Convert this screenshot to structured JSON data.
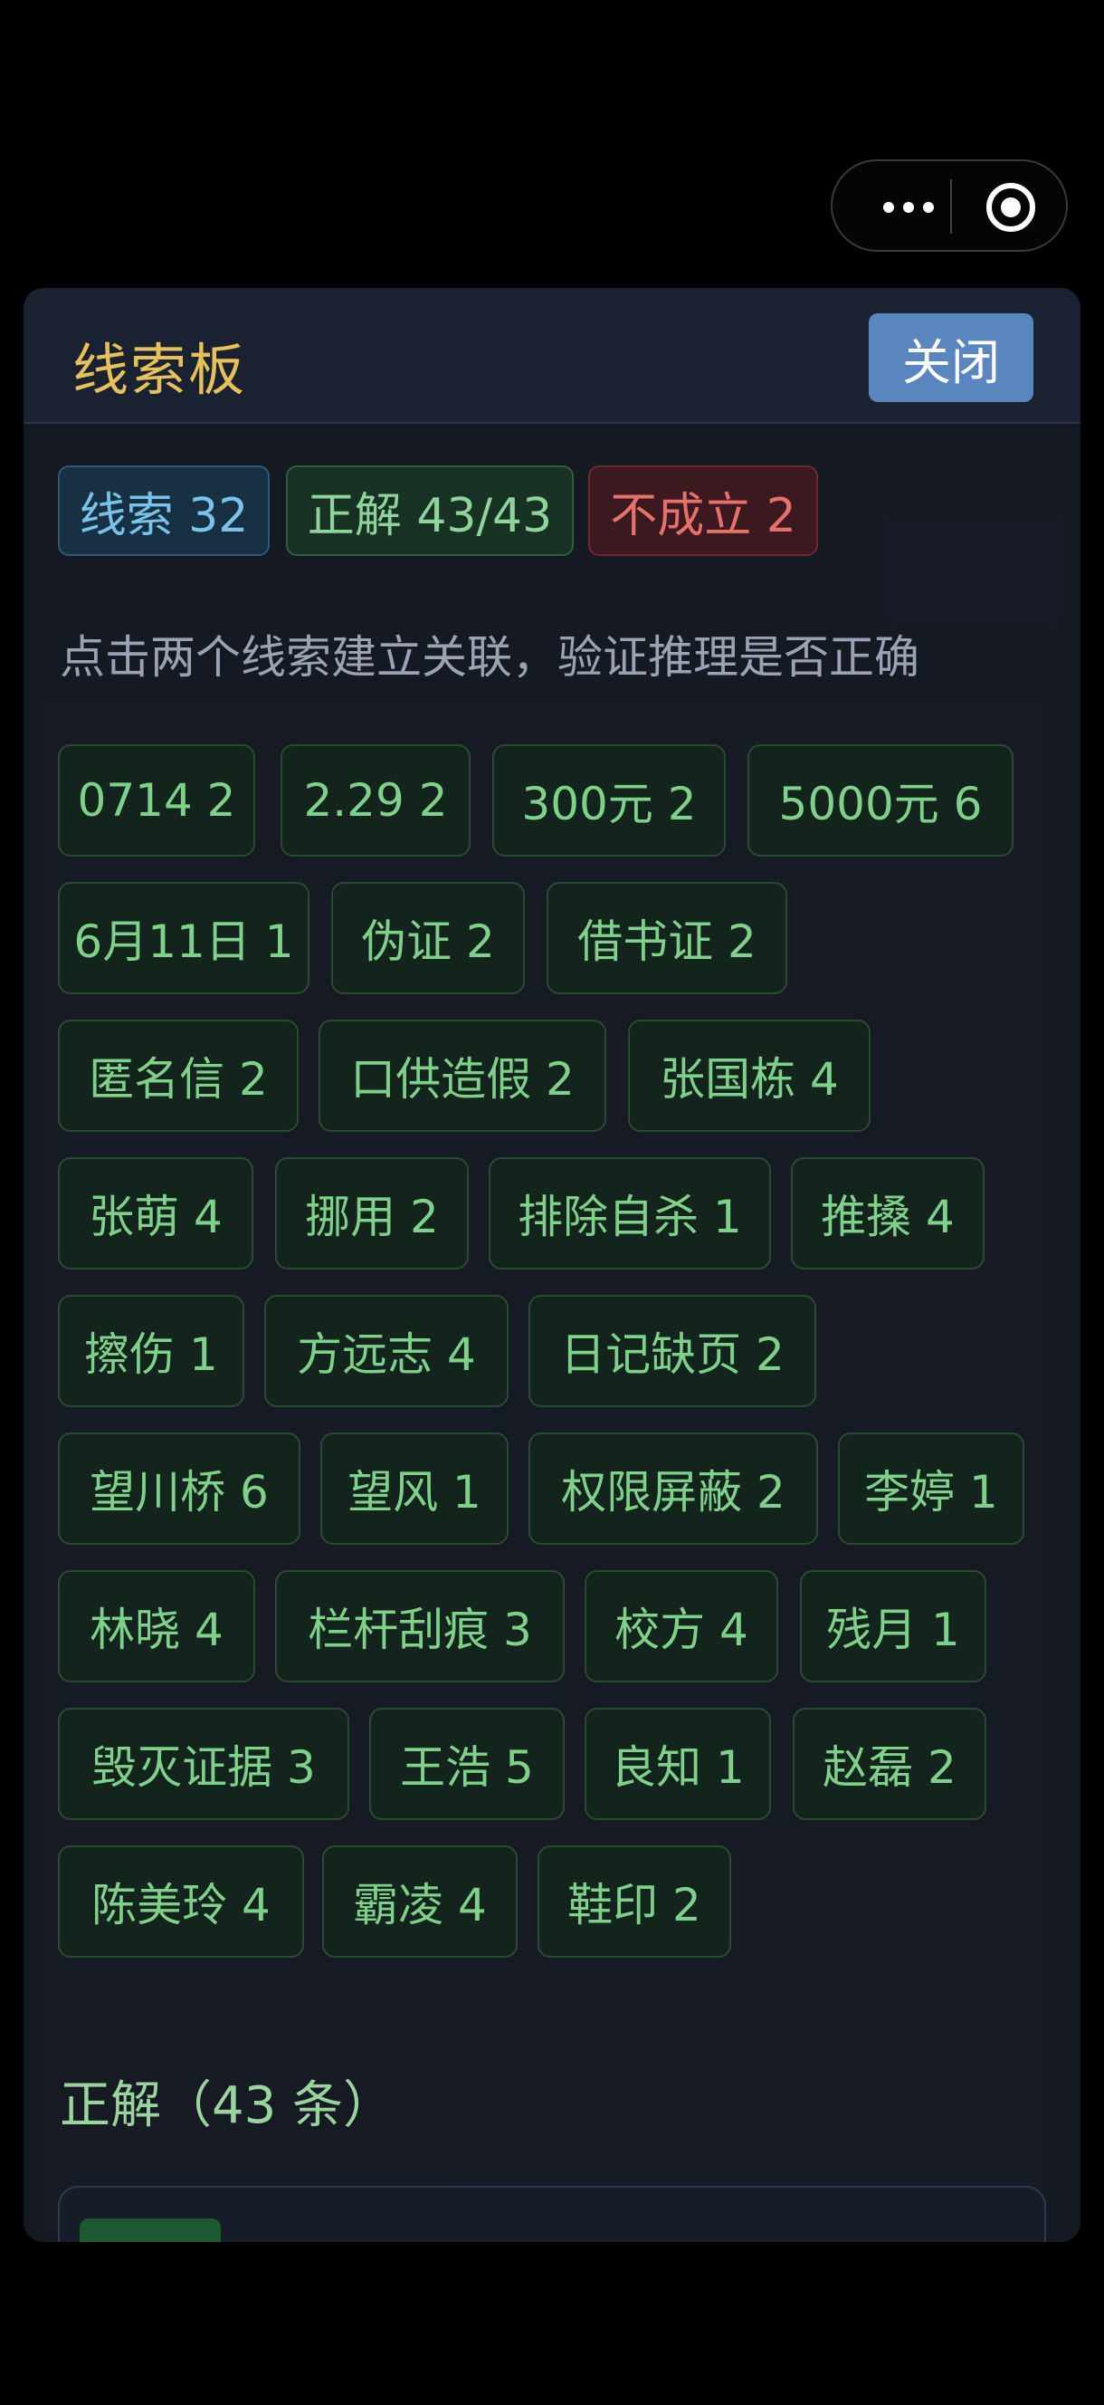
{
  "capsule": {
    "more_icon": "more-dots-icon",
    "close_icon": "target-circle-icon"
  },
  "panel": {
    "title": "线索板",
    "close_label": "关闭"
  },
  "badges": {
    "clues": "线索 32",
    "correct": "正解 43/43",
    "invalid": "不成立 2"
  },
  "hint": "点击两个线索建立关联，验证推理是否正确",
  "clues": [
    "0714 2",
    "2.29 2",
    "300元 2",
    "5000元 6",
    "6月11日 1",
    "伪证 2",
    "借书证 2",
    "匿名信 2",
    "口供造假 2",
    "张国栋 4",
    "张萌 4",
    "挪用 2",
    "排除自杀 1",
    "推搡 4",
    "擦伤 1",
    "方远志 4",
    "日记缺页 2",
    "望川桥 6",
    "望风 1",
    "权限屏蔽 2",
    "李婷 1",
    "林晓 4",
    "栏杆刮痕 3",
    "校方 4",
    "残月 1",
    "毁灭证据 3",
    "王浩 5",
    "良知 1",
    "赵磊 2",
    "陈美玲 4",
    "霸凌 4",
    "鞋印 2"
  ],
  "section_title": "正解（43 条）",
  "colors": {
    "accent_title": "#e6c15a",
    "close_button": "#5a86c0",
    "chip_text": "#7fd08a"
  }
}
